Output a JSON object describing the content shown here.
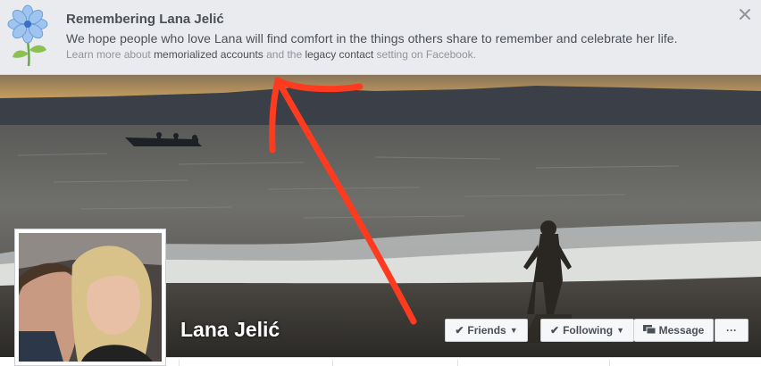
{
  "banner": {
    "title": "Remembering Lana Jelić",
    "body": "We hope people who love Lana will find comfort in the things others share to remember and celebrate her life.",
    "learn_prefix": "Learn more about ",
    "memorialized_link": "memorialized accounts",
    "learn_middle": " and the ",
    "legacy_link": "legacy contact",
    "learn_suffix": " setting on Facebook.",
    "flower_icon": "forget-me-not-flower",
    "close_icon": "close-x"
  },
  "profile": {
    "name": "Lana Jelić"
  },
  "actions": {
    "friends_label": "Friends",
    "following_label": "Following",
    "message_label": "Message",
    "more_label": "···"
  },
  "colors": {
    "annotation_arrow": "#ff3b1f",
    "banner_bg": "#e9ebee"
  }
}
